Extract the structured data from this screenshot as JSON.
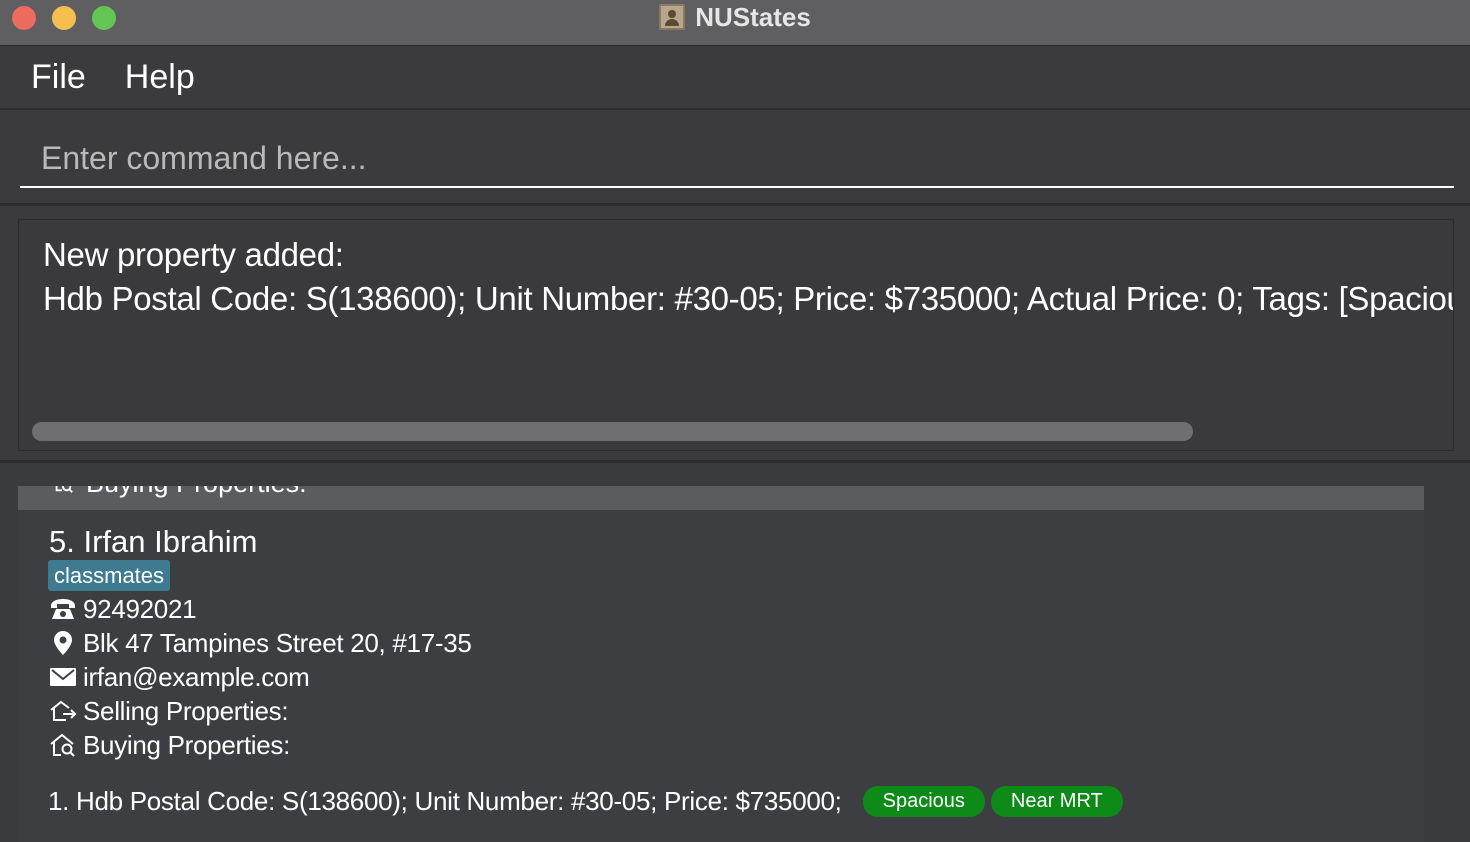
{
  "window": {
    "title": "NUStates"
  },
  "menu": {
    "file": "File",
    "help": "Help"
  },
  "command": {
    "placeholder": "Enter command here...",
    "value": ""
  },
  "result": {
    "line1": "New property added:",
    "line2": "Hdb Postal Code: S(138600);  Unit Number: #30-05;  Price: $735000;  Actual Price: 0; Tags: [Spacious][Near MRT]"
  },
  "previous_card": {
    "buying_label": "Buying Properties:"
  },
  "person": {
    "name": "5. Irfan Ibrahim",
    "tag": "classmates",
    "phone": "92492021",
    "address": "Blk 47 Tampines Street 20, #17-35",
    "email": "irfan@example.com",
    "selling_label": "Selling Properties:",
    "buying_label": "Buying Properties:",
    "buying": [
      {
        "text": "1. Hdb Postal Code: S(138600);  Unit Number: #30-05;  Price: $735000;",
        "tags": [
          "Spacious",
          "Near MRT"
        ]
      }
    ]
  },
  "colors": {
    "person_tag": "#3e7b91",
    "property_tag": "#0d8a17",
    "background": "#3a3b3d",
    "titlebar": "#5f5e60"
  },
  "icons": [
    "phone-icon",
    "location-pin-icon",
    "envelope-icon",
    "house-arrow-icon",
    "house-search-icon"
  ]
}
